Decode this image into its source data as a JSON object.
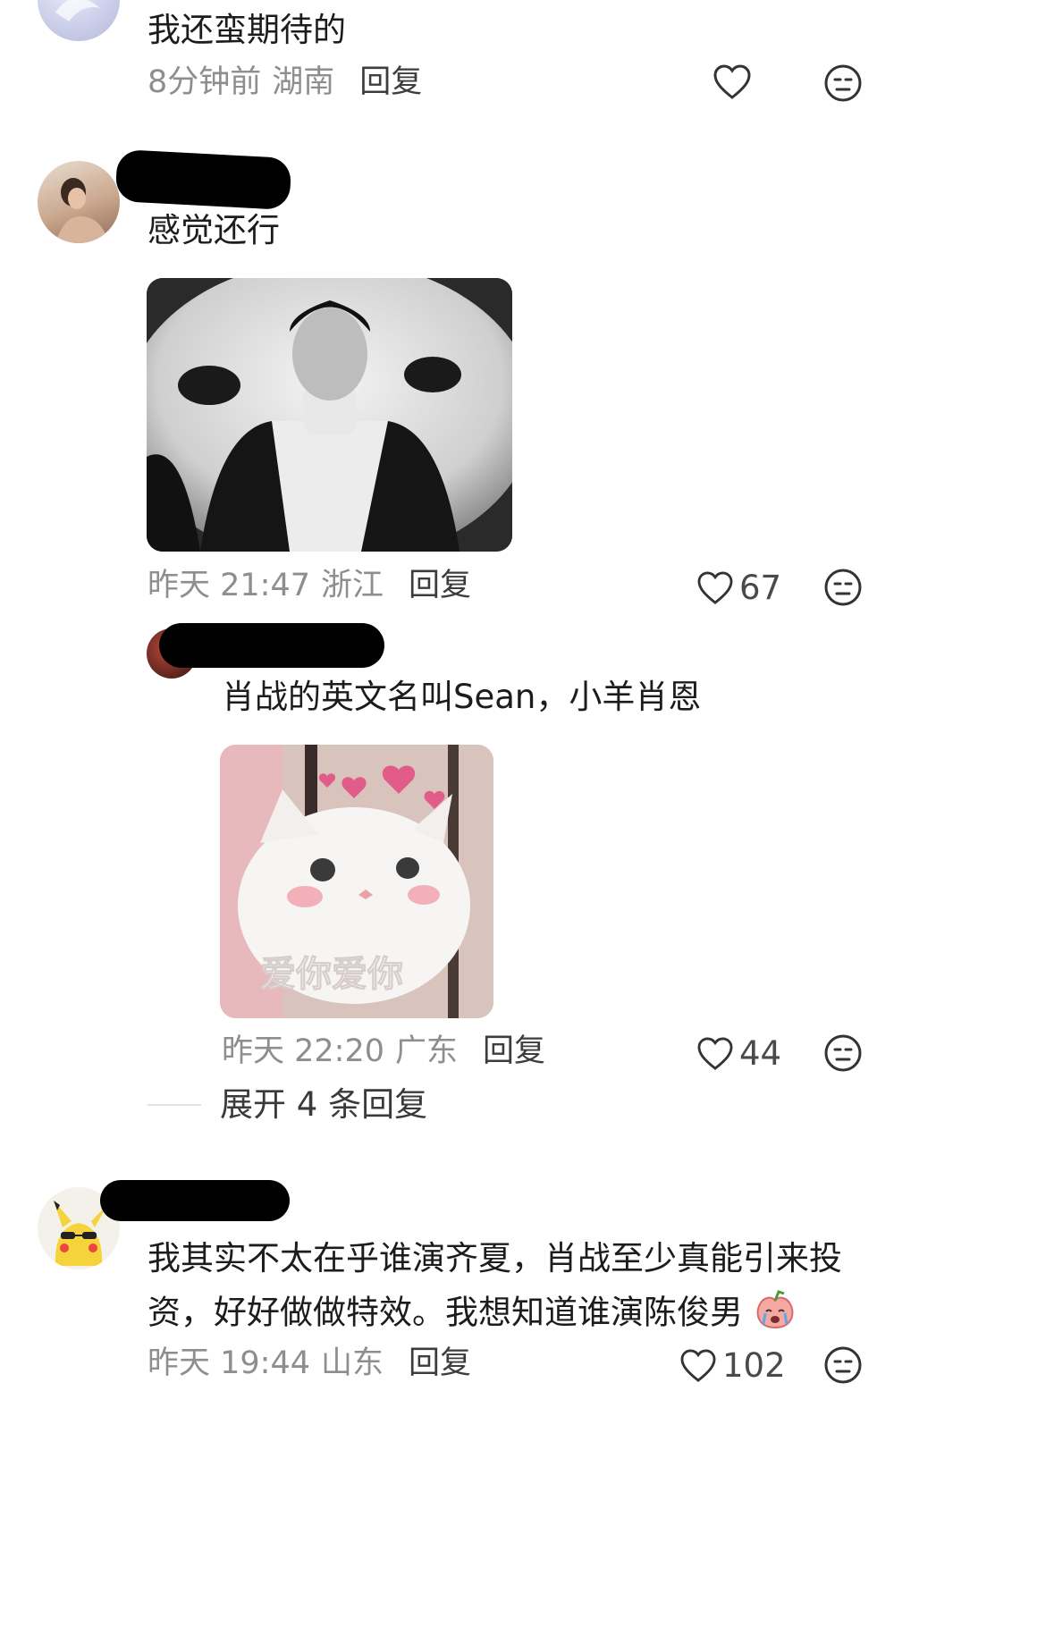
{
  "comments": [
    {
      "text": "我还蛮期待的",
      "time": "8分钟前",
      "location": "湖南",
      "reply_label": "回复",
      "likes": ""
    },
    {
      "text": "感觉还行",
      "time": "昨天 21:47",
      "location": "浙江",
      "reply_label": "回复",
      "likes": "67",
      "reply": {
        "text": "肖战的英文名叫Sean，小羊肖恩",
        "sticker_text": "爱你爱你",
        "time": "昨天 22:20",
        "location": "广东",
        "reply_label": "回复",
        "likes": "44"
      },
      "expand_label": "展开 4 条回复"
    },
    {
      "text_line1": "我其实不太在乎谁演齐夏，肖战至少真能引来投",
      "text_line2": "资，好好做做特效。我想知道谁演陈俊男",
      "time": "昨天 19:44",
      "location": "山东",
      "reply_label": "回复",
      "likes": "102"
    }
  ],
  "icons": {
    "like": "heart-outline-icon",
    "dislike": "unamused-face-icon",
    "emoji": "crying-peach-emoji-icon"
  },
  "colors": {
    "text": "#1c1c1c",
    "meta": "#8e8e8e",
    "reply": "#3d3d3d"
  }
}
